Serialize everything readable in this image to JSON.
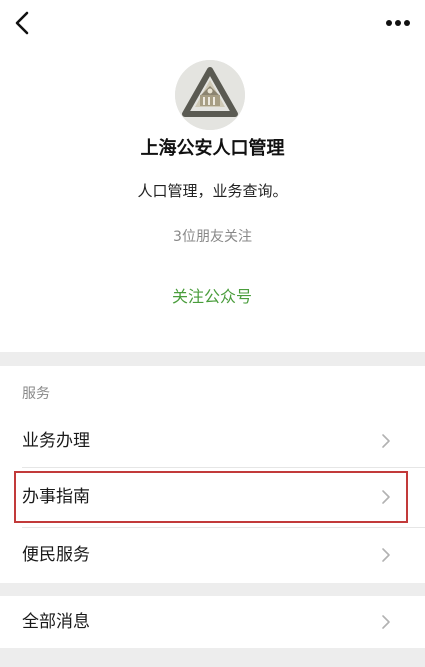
{
  "profile": {
    "name": "上海公安人口管理",
    "description": "人口管理，业务查询。",
    "followers": "3位朋友关注",
    "follow_button": "关注公众号"
  },
  "icons": {
    "back": "back-chevron-icon",
    "more": "more-dots-icon",
    "row_chevron": "chevron-right-icon",
    "avatar": "police-emblem-logo"
  },
  "services": {
    "title": "服务",
    "items": [
      {
        "label": "业务办理"
      },
      {
        "label": "办事指南",
        "highlighted": true
      },
      {
        "label": "便民服务"
      }
    ]
  },
  "messages": {
    "label": "全部消息"
  },
  "colors": {
    "accent_green": "#4a9d3c",
    "highlight_red": "#c23a3a",
    "page_background": "#ededed"
  }
}
